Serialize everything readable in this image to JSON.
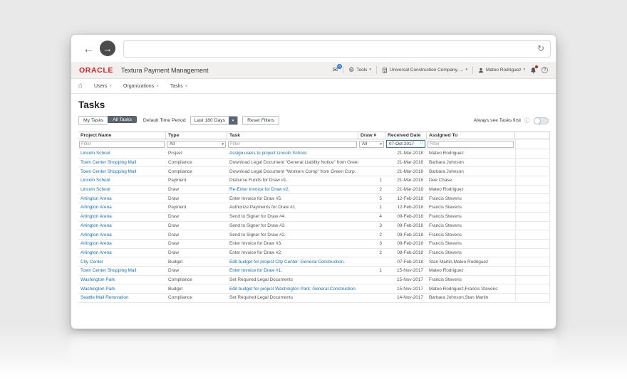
{
  "icons": {
    "back": "←",
    "forward": "→",
    "refresh": "↻",
    "home": "⌂",
    "info": "ⓘ",
    "help": "?",
    "envelope": "✉",
    "tools": "⚙",
    "calendar": "∷",
    "caret": "▾",
    "chevron": "∨"
  },
  "colors": {
    "oracle_red": "#e21f26",
    "link_blue": "#1b75bb",
    "slate": "#5b6770",
    "filter_focus_border": "#2e7ac0"
  },
  "app_header": {
    "logo": "ORACLE",
    "title": "Textura Payment Management",
    "inbox_badge": "6",
    "tools": "Tools",
    "company": "Universal Construction Company, ...",
    "user": "Mateo Rodriguez"
  },
  "nav": {
    "items": [
      {
        "label": "Users"
      },
      {
        "label": "Organizations"
      },
      {
        "label": "Tasks"
      }
    ]
  },
  "page": {
    "title": "Tasks",
    "filters_bar": {
      "my_tasks": "My Tasks",
      "all_tasks": "All Tasks",
      "time_period_label": "Default Time Period",
      "time_period_value": "Last 180 Days",
      "reset": "Reset Filters",
      "always_see": "Always see Tasks first"
    }
  },
  "table": {
    "columns": [
      "Project Name",
      "Type",
      "Task",
      "Draw #",
      "Received Date",
      "Assigned To",
      ""
    ],
    "filter_row": {
      "project_placeholder": "Filter",
      "type_value": "All",
      "task_placeholder": "Filter",
      "draw_value": "All",
      "received_value": "07-Oct-2017",
      "assigned_placeholder": "Filter"
    },
    "rows": [
      {
        "project": "Lincoln School",
        "type": "Project",
        "task": "Assign users to project Lincoln School.",
        "task_link": true,
        "draw": "",
        "received": "21-Mar-2018",
        "assigned": "Mateo Rodriguez"
      },
      {
        "project": "Town Center Shopping Mall",
        "type": "Compliance",
        "task": "Download Legal Document \"General Liability Notice\" from Green ...",
        "task_link": false,
        "draw": "",
        "received": "21-Mar-2018",
        "assigned": "Barbara Johnson"
      },
      {
        "project": "Town Center Shopping Mall",
        "type": "Compliance",
        "task": "Download Legal Document \"Workers Comp\" from Green Corp.",
        "task_link": false,
        "draw": "",
        "received": "21-Mar-2018",
        "assigned": "Barbara Johnson"
      },
      {
        "project": "Lincoln School",
        "type": "Payment",
        "task": "Disburse Funds for Draw #1.",
        "task_link": false,
        "draw": "1",
        "received": "21-Mar-2018",
        "assigned": "Dee Chase"
      },
      {
        "project": "Lincoln School",
        "type": "Draw",
        "task": "Re-Enter Invoice for Draw #2.",
        "task_link": true,
        "draw": "2",
        "received": "21-Mar-2018",
        "assigned": "Mateo Rodriguez"
      },
      {
        "project": "Arlington Arena",
        "type": "Draw",
        "task": "Enter Invoice for Draw #5.",
        "task_link": false,
        "draw": "5",
        "received": "12-Feb-2018",
        "assigned": "Francis Stevens"
      },
      {
        "project": "Arlington Arena",
        "type": "Payment",
        "task": "Authorize Payments for Draw #1.",
        "task_link": false,
        "draw": "1",
        "received": "12-Feb-2018",
        "assigned": "Francis Stevens"
      },
      {
        "project": "Arlington Arena",
        "type": "Draw",
        "task": "Send to Signer for Draw #4.",
        "task_link": false,
        "draw": "4",
        "received": "09-Feb-2018",
        "assigned": "Francis Stevens"
      },
      {
        "project": "Arlington Arena",
        "type": "Draw",
        "task": "Send to Signer for Draw #3.",
        "task_link": false,
        "draw": "3",
        "received": "09-Feb-2018",
        "assigned": "Francis Stevens"
      },
      {
        "project": "Arlington Arena",
        "type": "Draw",
        "task": "Send to Signer for Draw #2.",
        "task_link": false,
        "draw": "2",
        "received": "09-Feb-2018",
        "assigned": "Francis Stevens"
      },
      {
        "project": "Arlington Arena",
        "type": "Draw",
        "task": "Enter Invoice for Draw #3.",
        "task_link": false,
        "draw": "3",
        "received": "08-Feb-2018",
        "assigned": "Francis Stevens"
      },
      {
        "project": "Arlington Arena",
        "type": "Draw",
        "task": "Enter Invoice for Draw #2.",
        "task_link": false,
        "draw": "2",
        "received": "08-Feb-2018",
        "assigned": "Francis Stevens"
      },
      {
        "project": "City Center",
        "type": "Budget",
        "task": "Edit budget for project City Center: General Construction.",
        "task_link": true,
        "draw": "",
        "received": "07-Feb-2018",
        "assigned": "Stan Martin,Mateo Rodriguez"
      },
      {
        "project": "Town Center Shopping Mall",
        "type": "Draw",
        "task": "Enter Invoice for Draw #1.",
        "task_link": true,
        "draw": "1",
        "received": "15-Nov-2017",
        "assigned": "Mateo Rodriguez"
      },
      {
        "project": "Washington Park",
        "type": "Compliance",
        "task": "Set Required Legal Documents",
        "task_link": false,
        "draw": "",
        "received": "15-Nov-2017",
        "assigned": "Francis Stevens"
      },
      {
        "project": "Washington Park",
        "type": "Budget",
        "task": "Edit budget for project Washington Park: General Construction.",
        "task_link": true,
        "draw": "",
        "received": "15-Nov-2017",
        "assigned": "Mateo Rodriguez,Francis Stevens"
      },
      {
        "project": "Seattle Mall Renovation",
        "type": "Compliance",
        "task": "Set Required Legal Documents",
        "task_link": false,
        "draw": "",
        "received": "14-Nov-2017",
        "assigned": "Barbara Johnson,Stan Martin"
      }
    ]
  }
}
